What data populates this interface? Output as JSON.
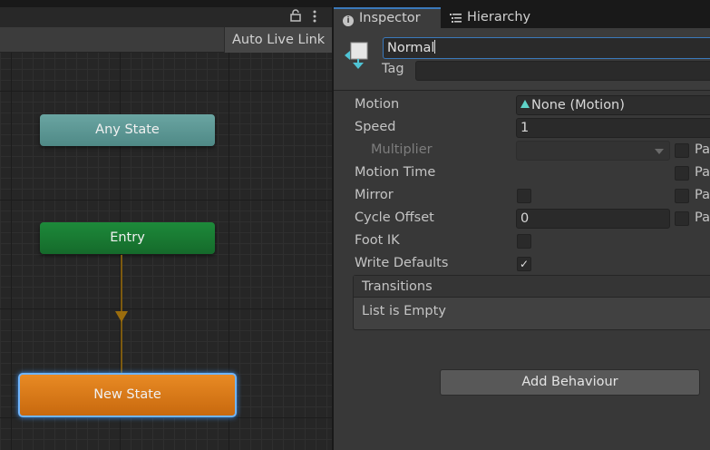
{
  "graph": {
    "auto_live_link": "Auto Live Link",
    "nodes": {
      "any_state": "Any State",
      "entry": "Entry",
      "new_state": "New State"
    }
  },
  "inspector": {
    "tabs": {
      "inspector": "Inspector",
      "hierarchy": "Hierarchy"
    },
    "name": "Normal",
    "tag_label": "Tag",
    "tag_value": "",
    "properties": {
      "motion_label": "Motion",
      "motion_value": "None (Motion)",
      "speed_label": "Speed",
      "speed_value": "1",
      "multiplier_label": "Multiplier",
      "motion_time_label": "Motion Time",
      "mirror_label": "Mirror",
      "cycle_offset_label": "Cycle Offset",
      "cycle_offset_value": "0",
      "foot_ik_label": "Foot IK",
      "write_defaults_label": "Write Defaults",
      "write_defaults_checked": true,
      "param_label": "Pa"
    },
    "transitions": {
      "header": "Transitions",
      "empty": "List is Empty"
    },
    "add_behaviour": "Add Behaviour"
  },
  "colors": {
    "accent": "#3a79bb",
    "any_state": "#5f9c99",
    "entry": "#1a7d34",
    "new_state": "#d97a18",
    "transition": "#8a6410"
  }
}
